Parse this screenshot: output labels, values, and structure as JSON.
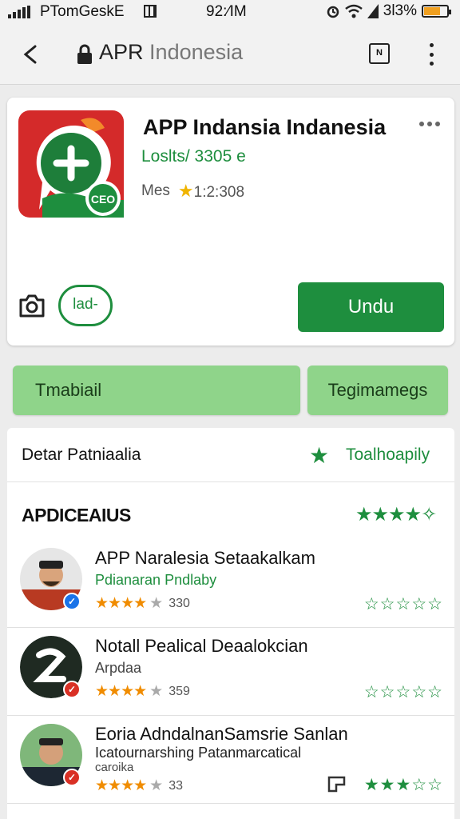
{
  "status": {
    "carrier": "PTomGeskE",
    "time": "92:⁄IM",
    "battery": "3l3%"
  },
  "browser": {
    "title_main": "APR",
    "title_rest": "Indonesia",
    "tab_count": "N"
  },
  "app": {
    "name": "APP Indansia Indanesia",
    "loads": "Loslts/ 3305 e",
    "meta_label": "Mes",
    "rating": "1:2:308",
    "pill_label": "lad-",
    "install_label": "Undu",
    "icon_badge": "CEO"
  },
  "actions": {
    "left": "Tmabiail",
    "right": "Tegimamegs"
  },
  "details": {
    "label": "Detar Patniaalia",
    "value": "Toalhoapily"
  },
  "reviews_header": {
    "title": "APDICEAIUS",
    "stars": "★★★★✧"
  },
  "reviews": [
    {
      "name": "APP Naralesia Setaakalkam",
      "subtitle": "Pdianaran Pndlaby",
      "subtitle_color": "#1e8e3e",
      "count": "330",
      "stars_full": "★★★★",
      "stars_extra": "★",
      "badge_color": "#1a73e8",
      "outline_stars": "☆☆☆☆☆",
      "flag": false,
      "subtitle2": ""
    },
    {
      "name": "Notall Pealical Deaalokcian",
      "subtitle": "Arpdaa",
      "subtitle_color": "#444444",
      "count": "359",
      "stars_full": "★★★★",
      "stars_extra": "★",
      "badge_color": "#d93025",
      "outline_stars": "☆☆☆☆☆",
      "flag": false,
      "subtitle2": ""
    },
    {
      "name": "Eoria AdndalnanSamsrie Sanlan",
      "subtitle": "Icatournarshing Patanmarcatical",
      "subtitle_color": "#222222",
      "subtitle2": "caroika",
      "count": "33",
      "stars_full": "★★★★",
      "stars_extra": "★",
      "badge_color": "#d93025",
      "outline_stars": "★★★☆☆",
      "flag": true
    }
  ]
}
